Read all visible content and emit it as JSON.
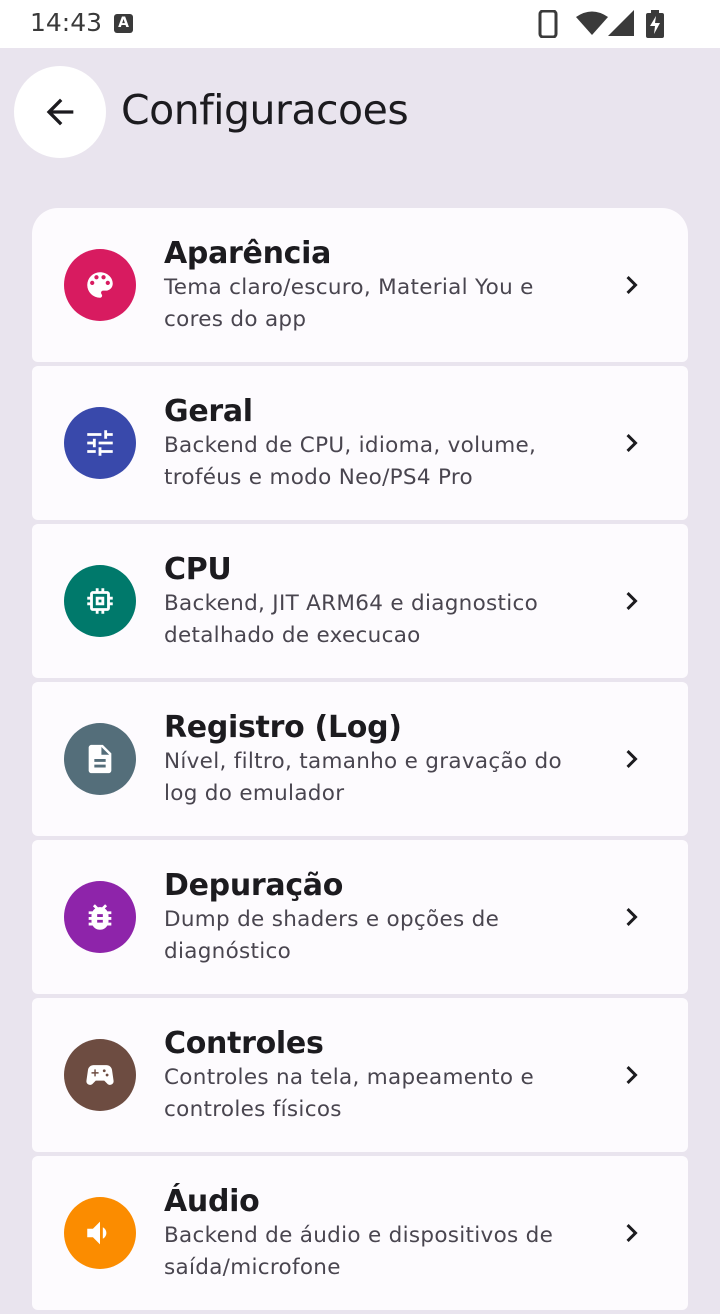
{
  "status_bar": {
    "time": "14:43",
    "notification_icon": "A"
  },
  "header": {
    "title": "Configuracoes",
    "back_icon": "arrow-back-icon"
  },
  "items": [
    {
      "title": "Aparência",
      "subtitle": "Tema claro/escuro, Material You e cores do app",
      "icon": "palette-icon",
      "color": "#d81b60"
    },
    {
      "title": "Geral",
      "subtitle": "Backend de CPU, idioma, volume, troféus e modo Neo/PS4 Pro",
      "icon": "tune-icon",
      "color": "#3949ab"
    },
    {
      "title": "CPU",
      "subtitle": "Backend, JIT ARM64 e diagnostico detalhado de execucao",
      "icon": "memory-icon",
      "color": "#00796b"
    },
    {
      "title": "Registro (Log)",
      "subtitle": "Nível, filtro, tamanho e gravação do log do emulador",
      "icon": "document-icon",
      "color": "#546e7a"
    },
    {
      "title": "Depuração",
      "subtitle": "Dump de shaders e opções de diagnóstico",
      "icon": "bug-icon",
      "color": "#8e24aa"
    },
    {
      "title": "Controles",
      "subtitle": "Controles na tela, mapeamento e controles físicos",
      "icon": "gamepad-icon",
      "color": "#6d4c41"
    },
    {
      "title": "Áudio",
      "subtitle": "Backend de áudio e dispositivos de saída/microfone",
      "icon": "volume-icon",
      "color": "#fb8c00"
    }
  ]
}
